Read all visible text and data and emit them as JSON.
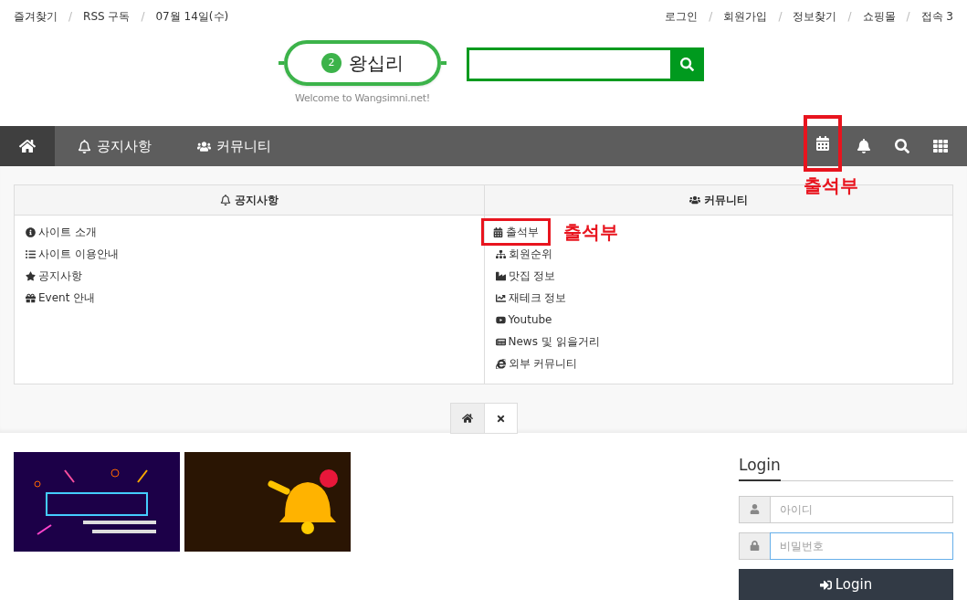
{
  "top_bar": {
    "separator": "/",
    "left": [
      "즐겨찾기",
      "RSS 구독",
      "07월 14일(수)"
    ],
    "right": [
      "로그인",
      "회원가입",
      "정보찾기",
      "쇼핑몰",
      "접속 3"
    ]
  },
  "logo": {
    "badge": "2",
    "title": "왕십리",
    "tagline": "Welcome to Wangsimni.net!"
  },
  "nav": {
    "items": [
      {
        "kind": "bell",
        "label": "공지사항"
      },
      {
        "kind": "users",
        "label": "커뮤니티"
      }
    ],
    "tools": [
      {
        "kind": "calendar",
        "highlighted": true
      },
      {
        "kind": "bell",
        "highlighted": false
      },
      {
        "kind": "search",
        "highlighted": false
      },
      {
        "kind": "grid",
        "highlighted": false
      }
    ],
    "annotation": "출석부"
  },
  "mega_menu": {
    "columns": [
      {
        "kind": "bell",
        "title": "공지사항",
        "items": [
          {
            "kind": "info",
            "label": "사이트 소개",
            "highlighted": false
          },
          {
            "kind": "list",
            "label": "사이트 이용안내",
            "highlighted": false
          },
          {
            "kind": "star",
            "label": "공지사항",
            "highlighted": false
          },
          {
            "kind": "gift",
            "label": "Event 안내",
            "highlighted": false
          }
        ]
      },
      {
        "kind": "users",
        "title": "커뮤니티",
        "items": [
          {
            "kind": "calendar",
            "label": "출석부",
            "highlighted": true
          },
          {
            "kind": "sitemap",
            "label": "회원순위",
            "highlighted": false
          },
          {
            "kind": "food",
            "label": "맛집 정보",
            "highlighted": false
          },
          {
            "kind": "chart",
            "label": "재테크 정보",
            "highlighted": false
          },
          {
            "kind": "youtube",
            "label": "Youtube",
            "highlighted": false
          },
          {
            "kind": "news",
            "label": "News 및 읽을거리",
            "highlighted": false
          },
          {
            "kind": "ie",
            "label": "외부 커뮤니티",
            "highlighted": false
          }
        ]
      }
    ],
    "annotation": "출석부"
  },
  "banners": [
    {
      "kind": "welcome"
    },
    {
      "kind": "notice"
    }
  ],
  "login": {
    "title": "Login",
    "fields": [
      {
        "kind": "user",
        "placeholder": "아이디",
        "focused": false
      },
      {
        "kind": "lock",
        "placeholder": "비밀번호",
        "focused": true
      }
    ],
    "button": "Login"
  }
}
